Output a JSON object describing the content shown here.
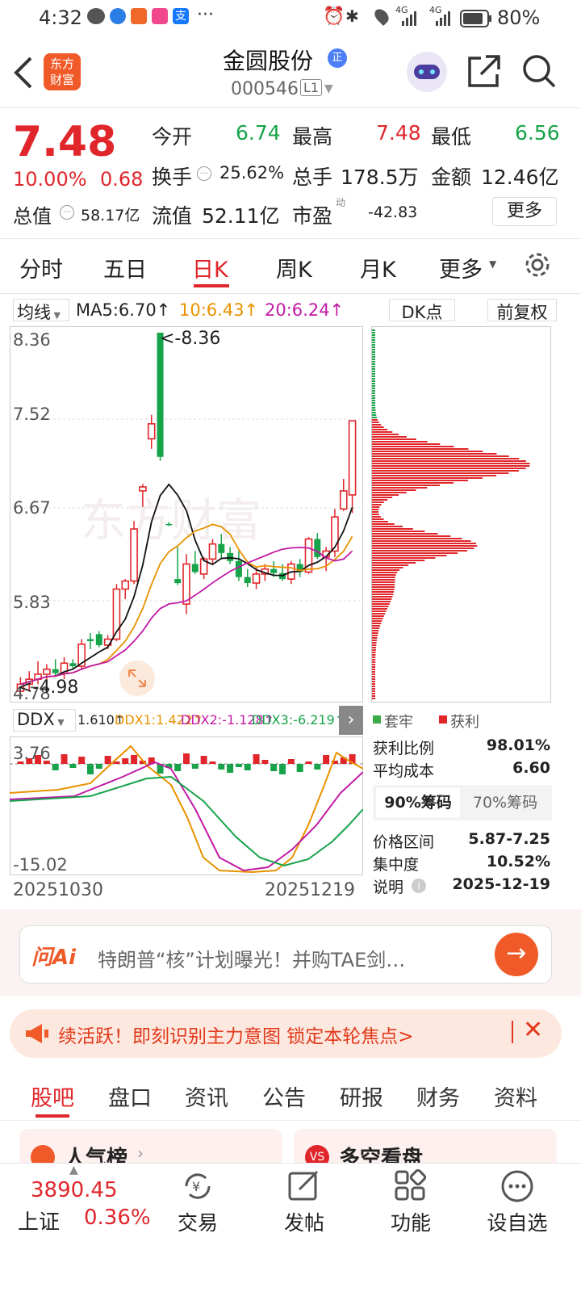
{
  "status_bar": {
    "time": "4:32",
    "battery": "80%",
    "net1": "4G",
    "net2": "4G"
  },
  "header": {
    "logo_line1": "东方",
    "logo_line2": "财富",
    "name": "金圆股份",
    "code": "000546",
    "level": "L1",
    "badge": "正"
  },
  "quote": {
    "price": "7.48",
    "change_pct": "10.00%",
    "change": "0.68",
    "open_label": "今开",
    "open": "6.74",
    "high_label": "最高",
    "high": "7.48",
    "low_label": "最低",
    "low": "6.56",
    "turnover_label": "换手",
    "turnover": "25.62%",
    "volume_label": "总手",
    "volume": "178.5万",
    "amount_label": "金额",
    "amount": "12.46亿",
    "mktcap_label": "总值",
    "mktcap": "58.17亿",
    "float_label": "流值",
    "float": "52.11亿",
    "pe_label": "市盈",
    "pe_sup": "动",
    "pe": "-42.83",
    "more": "更多"
  },
  "period_tabs": [
    "分时",
    "五日",
    "日K",
    "周K",
    "月K",
    "更多"
  ],
  "ma_bar": {
    "selector": "均线",
    "ma5": "MA5:6.70↑",
    "ma10": "10:6.43↑",
    "ma20": "20:6.24↑",
    "dk": "DK点",
    "fq": "前复权"
  },
  "kline": {
    "y_labels": [
      "8.36",
      "7.52",
      "6.67",
      "5.83",
      "4.78"
    ],
    "hi_label": "<-8.36",
    "lo_label": "<-4.98",
    "watermark": "东方财富"
  },
  "ddx": {
    "selector": "DDX",
    "ddx": "1.610↑",
    "ddx1": "DDX1:1.422↑",
    "ddx2": "DDX2:-1.128↑",
    "ddx3": "DDX3:-6.219↑",
    "y_top": "3.76",
    "y_bottom": "-15.02",
    "date_start": "20251030",
    "date_end": "20251219"
  },
  "chips": {
    "legend_trap": "套牢",
    "legend_profit": "获利",
    "rows": [
      {
        "label": "获利比例",
        "value": "98.01%"
      },
      {
        "label": "平均成本",
        "value": "6.60"
      }
    ],
    "tab90": "90%筹码",
    "tab70": "70%筹码",
    "rows2": [
      {
        "label": "价格区间",
        "value": "5.87-7.25"
      },
      {
        "label": "集中度",
        "value": "10.52%"
      },
      {
        "label": "说明",
        "value": "2025-12-19"
      }
    ]
  },
  "ai": {
    "logo": "问Ai",
    "text": "特朗普“核”计划曝光！并购TAE剑…"
  },
  "notice": {
    "text": "续活跃！即刻识别主力意图 锁定本轮焦点>"
  },
  "sub_tabs": [
    "股吧",
    "盘口",
    "资讯",
    "公告",
    "研报",
    "财务",
    "资料"
  ],
  "cards": {
    "left": "人气榜",
    "right": "多空看盘"
  },
  "bottom": {
    "index_value": "3890.45",
    "index_name": "上证",
    "index_change": "0.36%",
    "items": [
      "交易",
      "发帖",
      "功能",
      "设自选"
    ]
  },
  "colors": {
    "up": "#e0262b",
    "down": "#17a34a",
    "accent": "#f05a28"
  },
  "candles": [
    {
      "o": 4.78,
      "h": 4.92,
      "l": 4.7,
      "c": 4.85
    },
    {
      "o": 4.85,
      "h": 4.98,
      "l": 4.78,
      "c": 4.9
    },
    {
      "o": 4.9,
      "h": 5.08,
      "l": 4.85,
      "c": 4.95
    },
    {
      "o": 4.95,
      "h": 5.05,
      "l": 4.88,
      "c": 5.0
    },
    {
      "o": 5.0,
      "h": 5.1,
      "l": 4.92,
      "c": 4.96
    },
    {
      "o": 4.96,
      "h": 5.12,
      "l": 4.9,
      "c": 5.06
    },
    {
      "o": 5.06,
      "h": 5.1,
      "l": 5.0,
      "c": 5.03
    },
    {
      "o": 5.03,
      "h": 5.3,
      "l": 5.0,
      "c": 5.25
    },
    {
      "o": 5.3,
      "h": 5.36,
      "l": 5.2,
      "c": 5.28
    },
    {
      "o": 5.35,
      "h": 5.38,
      "l": 5.22,
      "c": 5.24
    },
    {
      "o": 5.24,
      "h": 5.34,
      "l": 5.2,
      "c": 5.3
    },
    {
      "o": 5.3,
      "h": 5.85,
      "l": 5.28,
      "c": 5.8
    },
    {
      "o": 5.8,
      "h": 5.9,
      "l": 5.7,
      "c": 5.88
    },
    {
      "o": 5.88,
      "h": 6.48,
      "l": 5.85,
      "c": 6.4
    },
    {
      "o": 6.78,
      "h": 6.85,
      "l": 6.62,
      "c": 6.82
    },
    {
      "o": 7.3,
      "h": 7.54,
      "l": 7.2,
      "c": 7.45
    },
    {
      "o": 8.36,
      "h": 8.36,
      "l": 7.08,
      "c": 7.12
    },
    {
      "o": 6.45,
      "h": 6.47,
      "l": 6.43,
      "c": 6.44
    },
    {
      "o": 5.9,
      "h": 6.22,
      "l": 5.84,
      "c": 5.86
    },
    {
      "o": 5.65,
      "h": 6.15,
      "l": 5.55,
      "c": 6.05
    },
    {
      "o": 6.05,
      "h": 6.18,
      "l": 5.95,
      "c": 5.97
    },
    {
      "o": 5.95,
      "h": 6.12,
      "l": 5.9,
      "c": 6.1
    },
    {
      "o": 6.1,
      "h": 6.3,
      "l": 6.05,
      "c": 6.25
    },
    {
      "o": 6.25,
      "h": 6.35,
      "l": 6.1,
      "c": 6.16
    },
    {
      "o": 6.16,
      "h": 6.22,
      "l": 6.05,
      "c": 6.08
    },
    {
      "o": 6.08,
      "h": 6.18,
      "l": 5.88,
      "c": 5.92
    },
    {
      "o": 5.92,
      "h": 6.0,
      "l": 5.82,
      "c": 5.86
    },
    {
      "o": 5.86,
      "h": 6.02,
      "l": 5.8,
      "c": 5.95
    },
    {
      "o": 5.95,
      "h": 6.05,
      "l": 5.88,
      "c": 6.0
    },
    {
      "o": 6.0,
      "h": 6.08,
      "l": 5.92,
      "c": 5.96
    },
    {
      "o": 5.96,
      "h": 6.05,
      "l": 5.88,
      "c": 5.9
    },
    {
      "o": 5.9,
      "h": 6.08,
      "l": 5.85,
      "c": 6.05
    },
    {
      "o": 6.05,
      "h": 6.1,
      "l": 5.92,
      "c": 5.97
    },
    {
      "o": 5.97,
      "h": 6.32,
      "l": 5.95,
      "c": 6.3
    },
    {
      "o": 6.3,
      "h": 6.36,
      "l": 6.1,
      "c": 6.12
    },
    {
      "o": 6.12,
      "h": 6.22,
      "l": 5.98,
      "c": 6.18
    },
    {
      "o": 6.18,
      "h": 6.6,
      "l": 6.12,
      "c": 6.52
    },
    {
      "o": 6.6,
      "h": 6.9,
      "l": 6.58,
      "c": 6.78
    },
    {
      "o": 6.74,
      "h": 7.48,
      "l": 6.56,
      "c": 7.48
    }
  ]
}
